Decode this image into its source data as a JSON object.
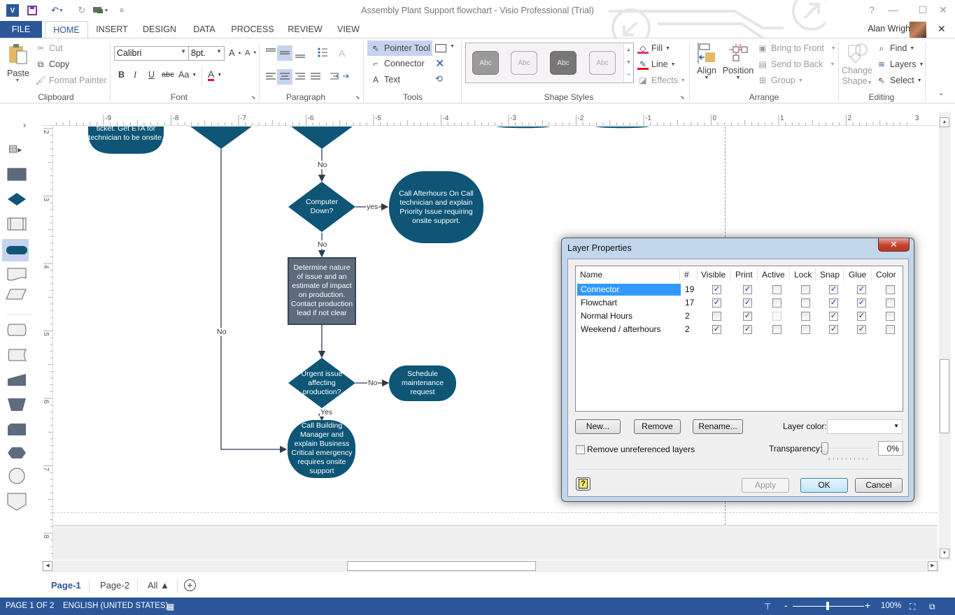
{
  "window": {
    "title": "Assembly Plant Support flowchart - Visio Professional (Trial)",
    "controls": [
      "?",
      "—",
      "☐",
      "✕"
    ]
  },
  "qat": {
    "app_icon": "visio-logo-icon",
    "save": "save-icon",
    "undo": "undo-icon",
    "redo": "redo-icon",
    "present": "present-icon",
    "customize": "customize-qat-icon"
  },
  "tabs": [
    {
      "label": "FILE"
    },
    {
      "label": "HOME",
      "active": true
    },
    {
      "label": "INSERT"
    },
    {
      "label": "DESIGN"
    },
    {
      "label": "DATA"
    },
    {
      "label": "PROCESS"
    },
    {
      "label": "REVIEW"
    },
    {
      "label": "VIEW"
    }
  ],
  "user": {
    "name": "Alan Wright",
    "close": "✕"
  },
  "ribbon": {
    "clipboard": {
      "label": "Clipboard",
      "paste": "Paste",
      "cut": "Cut",
      "copy": "Copy",
      "format_painter": "Format Painter"
    },
    "font": {
      "label": "Font",
      "family": "Calibri",
      "size": "8pt.",
      "bold": "B",
      "italic": "I",
      "underline": "U",
      "strike": "abc",
      "case": "Aa",
      "color_glyph": "A",
      "grow": "A",
      "shrink": "A",
      "accent": "#e81123"
    },
    "paragraph": {
      "label": "Paragraph"
    },
    "tools": {
      "label": "Tools",
      "pointer": "Pointer Tool",
      "connector": "Connector",
      "text": "Text"
    },
    "shape_styles": {
      "label": "Shape Styles",
      "styles": [
        "Abc",
        "Abc",
        "Abc",
        "Abc"
      ],
      "fill": "Fill",
      "line": "Line",
      "effects": "Effects"
    },
    "arrange": {
      "label": "Arrange",
      "align": "Align",
      "position": "Position",
      "bring_front": "Bring to Front",
      "send_back": "Send to Back",
      "group": "Group"
    },
    "editing": {
      "label": "Editing",
      "change_shape_1": "Change",
      "change_shape_2": "Shape",
      "find": "Find",
      "layers": "Layers",
      "select": "Select"
    }
  },
  "rulers": {
    "h_ticks": [
      "-9",
      "-8",
      "-7",
      "-6",
      "-5",
      "-4",
      "-3",
      "-2",
      "-1",
      "0",
      "1",
      "2",
      "3"
    ],
    "v_ticks": [
      "2",
      "3",
      "4",
      "5",
      "6",
      "7",
      "8"
    ]
  },
  "flowchart": {
    "color_primary": "#0e5576",
    "color_process": "#5d6b7d",
    "shapes": {
      "top_left_terminator": "ticket. Get ETA for technician to be onsite.",
      "decision_computer_down": "Computer Down?",
      "afterhours_call": "Call Afterhours On Call technician and explain Priority Issue requiring onsite support.",
      "determine_nature": "Determine nature of issue and an estimate of impact on production. Contact production lead if not clear",
      "decision_urgent": "Urgent issue affecting production?",
      "schedule_maintenance": "Schedule maintenance request",
      "call_building_manager": "Call Building Manager and explain Business Critical emergency requires onsite support"
    },
    "labels": {
      "no_1": "No",
      "yes_1": "yes",
      "no_2": "No",
      "no_left": "No",
      "no_3": "No",
      "yes_2": "Yes"
    }
  },
  "page_tabs": [
    {
      "label": "Page-1",
      "active": true
    },
    {
      "label": "Page-2"
    },
    {
      "label": "All ▲"
    }
  ],
  "status": {
    "page": "PAGE 1 OF 2",
    "language": "ENGLISH (UNITED STATES)",
    "zoom": "100%",
    "zoom_level_percent": 100
  },
  "dialog": {
    "title": "Layer Properties",
    "columns": [
      "Name",
      "#",
      "Visible",
      "Print",
      "Active",
      "Lock",
      "Snap",
      "Glue",
      "Color"
    ],
    "layers": [
      {
        "name": "Connector",
        "count": "19",
        "visible": true,
        "print": true,
        "active": false,
        "lock": false,
        "snap": true,
        "glue": true,
        "color": false,
        "selected": true
      },
      {
        "name": "Flowchart",
        "count": "17",
        "visible": true,
        "print": true,
        "active": false,
        "lock": false,
        "snap": true,
        "glue": true,
        "color": false
      },
      {
        "name": "Normal Hours",
        "count": "2",
        "visible": false,
        "print": true,
        "active": false,
        "active_disabled": true,
        "lock": false,
        "snap": true,
        "glue": true,
        "color": false
      },
      {
        "name": "Weekend / afterhours",
        "count": "2",
        "visible": true,
        "print": true,
        "active": false,
        "lock": false,
        "snap": true,
        "glue": true,
        "color": false
      }
    ],
    "buttons": {
      "new": "New...",
      "remove": "Remove",
      "rename": "Rename...",
      "apply": "Apply",
      "ok": "OK",
      "cancel": "Cancel"
    },
    "layer_color_label": "Layer color:",
    "layer_color_value": "",
    "remove_unreferenced": "Remove unreferenced layers",
    "remove_unreferenced_checked": false,
    "transparency_label": "Transparency:",
    "transparency_value": "0%",
    "transparency_percent": 0,
    "selection_color": "#3399ff"
  }
}
